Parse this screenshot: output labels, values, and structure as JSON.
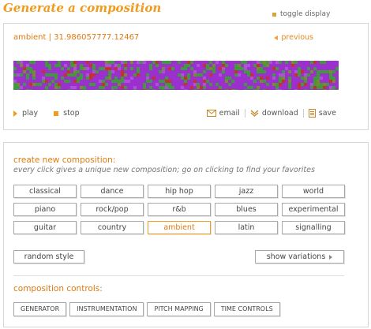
{
  "header": {
    "title": "Generate a composition",
    "toggle_label": "toggle display"
  },
  "player": {
    "composition_name": "ambient | 31.986057777.12467",
    "previous_label": "previous",
    "play_label": "play",
    "stop_label": "stop",
    "email_label": "email",
    "download_label": "download",
    "save_label": "save",
    "visual_colors": [
      "#9b30cf",
      "#3d9b3b",
      "#c7312a",
      "#7a8a2e",
      "#b04fdc"
    ]
  },
  "create": {
    "title": "create new composition:",
    "subtitle": "every click gives a unique new composition; go on clicking to find your favorites",
    "styles": [
      "classical",
      "dance",
      "hip hop",
      "jazz",
      "world",
      "piano",
      "rock/pop",
      "r&b",
      "blues",
      "experimental",
      "guitar",
      "country",
      "ambient",
      "latin",
      "signalling"
    ],
    "selected_style": "ambient",
    "random_label": "random style",
    "variations_label": "show variations"
  },
  "controls": {
    "title": "composition controls:",
    "buttons": [
      "GENERATOR",
      "INSTRUMENTATION",
      "PITCH MAPPING",
      "TIME CONTROLS"
    ]
  },
  "colors": {
    "accent": "#f29a1b",
    "link": "#e07a10"
  }
}
